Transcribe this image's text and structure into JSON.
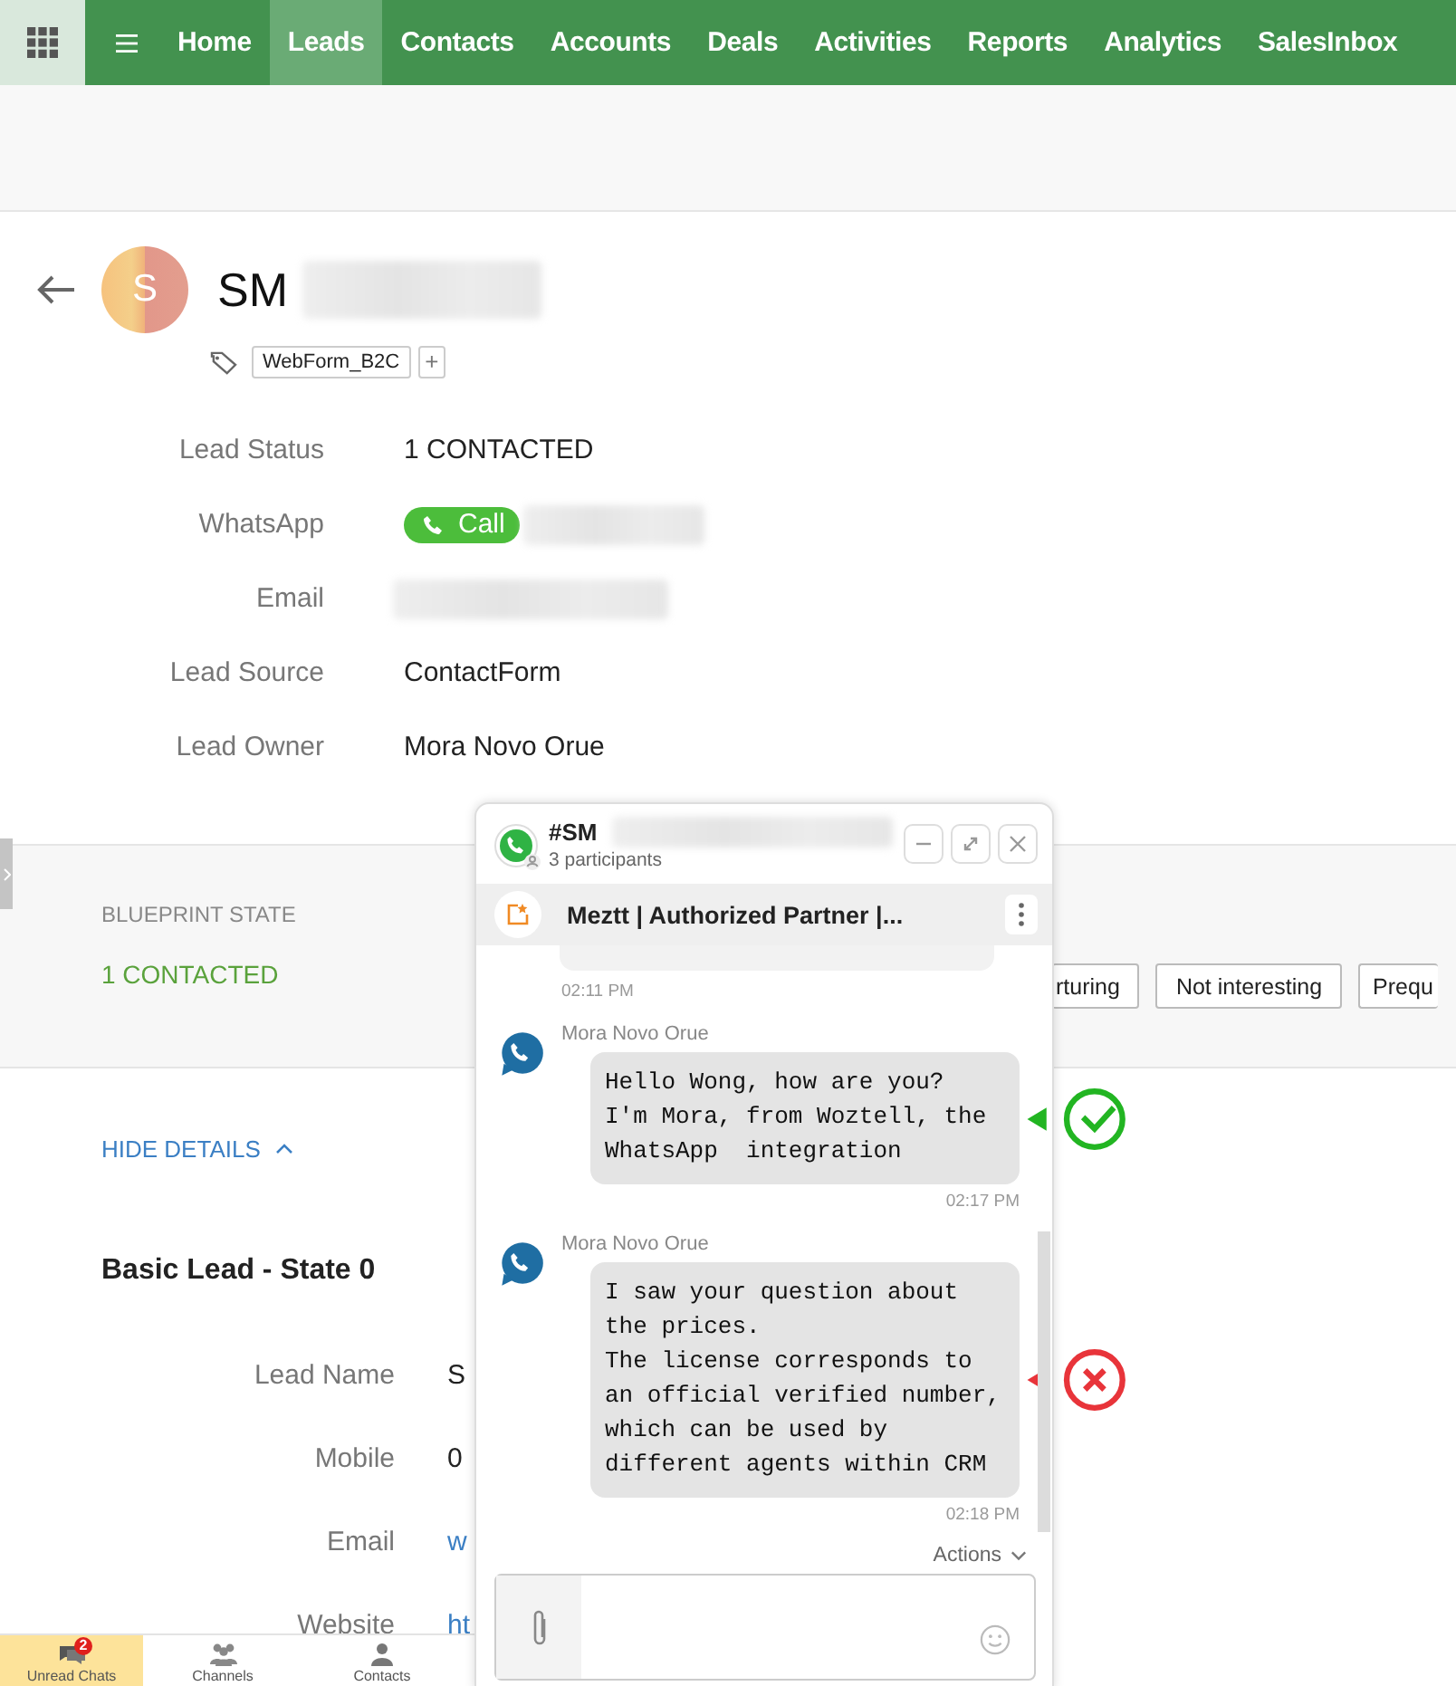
{
  "nav": {
    "items": [
      {
        "label": "Home",
        "selected": false
      },
      {
        "label": "Leads",
        "selected": true
      },
      {
        "label": "Contacts",
        "selected": false
      },
      {
        "label": "Accounts",
        "selected": false
      },
      {
        "label": "Deals",
        "selected": false
      },
      {
        "label": "Activities",
        "selected": false
      },
      {
        "label": "Reports",
        "selected": false
      },
      {
        "label": "Analytics",
        "selected": false
      },
      {
        "label": "SalesInbox",
        "selected": false
      }
    ]
  },
  "record": {
    "initial": "S",
    "title": "SM",
    "tags": [
      {
        "label": "WebForm_B2C"
      }
    ],
    "add_tag": "+",
    "fields": [
      {
        "label": "Lead Status",
        "kind": "text",
        "value": "1 CONTACTED"
      },
      {
        "label": "WhatsApp",
        "kind": "call",
        "button": "Call"
      },
      {
        "label": "Email",
        "kind": "redacted"
      },
      {
        "label": "Lead Source",
        "kind": "text",
        "value": "ContactForm"
      },
      {
        "label": "Lead Owner",
        "kind": "text",
        "value": "Mora Novo Orue"
      }
    ]
  },
  "blueprint": {
    "label": "BLUEPRINT STATE",
    "state": "1 CONTACTED",
    "transitions": [
      "rturing",
      "Not interesting",
      "Prequ"
    ]
  },
  "details": {
    "toggle": "HIDE DETAILS",
    "section_title": "Basic Lead - State 0",
    "fields": [
      {
        "label": "Lead Name",
        "value": "S",
        "kind": "text"
      },
      {
        "label": "Mobile",
        "value": "0",
        "kind": "text"
      },
      {
        "label": "Email",
        "value": "w",
        "kind": "link"
      },
      {
        "label": "Website",
        "value": "ht",
        "kind": "link"
      }
    ]
  },
  "chat": {
    "title": "#SM",
    "participants": "3 participants",
    "pinned": "Meztt | Authorized Partner |...",
    "earlier_time": "02:11 PM",
    "messages": [
      {
        "sender": "Mora Novo Orue",
        "text": "Hello Wong, how are you?\nI'm Mora, from Woztell, the\nWhatsApp  integration",
        "time": "02:17 PM",
        "kind": "check"
      },
      {
        "sender": "Mora Novo Orue",
        "text": "I saw your question about\nthe prices.\nThe license corresponds to\nan official verified number,\nwhich can be used by\ndifferent agents within CRM",
        "time": "02:18 PM",
        "kind": "cross"
      }
    ],
    "actions": "Actions"
  },
  "bottom_tabs": [
    {
      "label": "Unread Chats",
      "selected": true,
      "badge": "2",
      "kind": "chats"
    },
    {
      "label": "Channels",
      "selected": false,
      "kind": "channels"
    },
    {
      "label": "Contacts",
      "selected": false,
      "kind": "contacts"
    }
  ]
}
